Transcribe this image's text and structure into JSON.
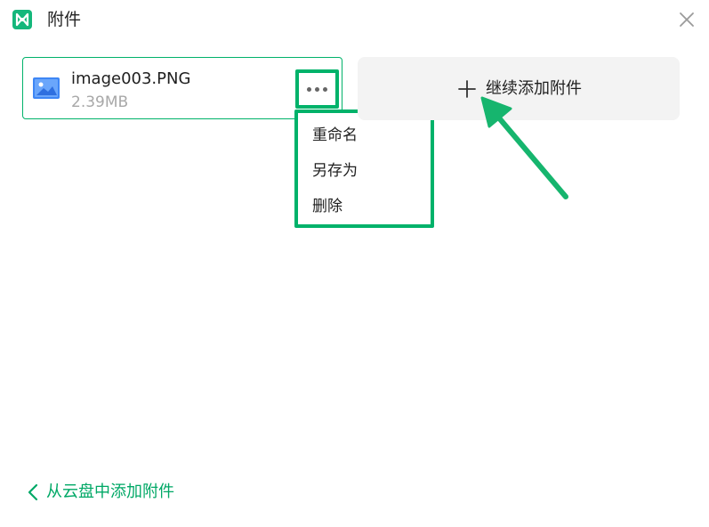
{
  "dialog": {
    "title": "附件",
    "logo_icon": "app-logo-icon",
    "close_icon": "close-icon"
  },
  "attachment": {
    "file_name": "image003.PNG",
    "file_size": "2.39MB",
    "file_icon": "image-file-icon",
    "more_icon": "more-horizontal-icon"
  },
  "context_menu": {
    "items": [
      {
        "label": "重命名"
      },
      {
        "label": "另存为"
      },
      {
        "label": "删除"
      }
    ]
  },
  "add_more": {
    "label": "继续添加附件",
    "icon": "plus-icon"
  },
  "cloud_link": {
    "label": "从云盘中添加附件",
    "icon": "chevron-left-icon"
  },
  "colors": {
    "accent": "#00b26a",
    "link": "#00a866",
    "card_bg": "#f3f3f3",
    "muted_text": "#a8a8a8"
  }
}
